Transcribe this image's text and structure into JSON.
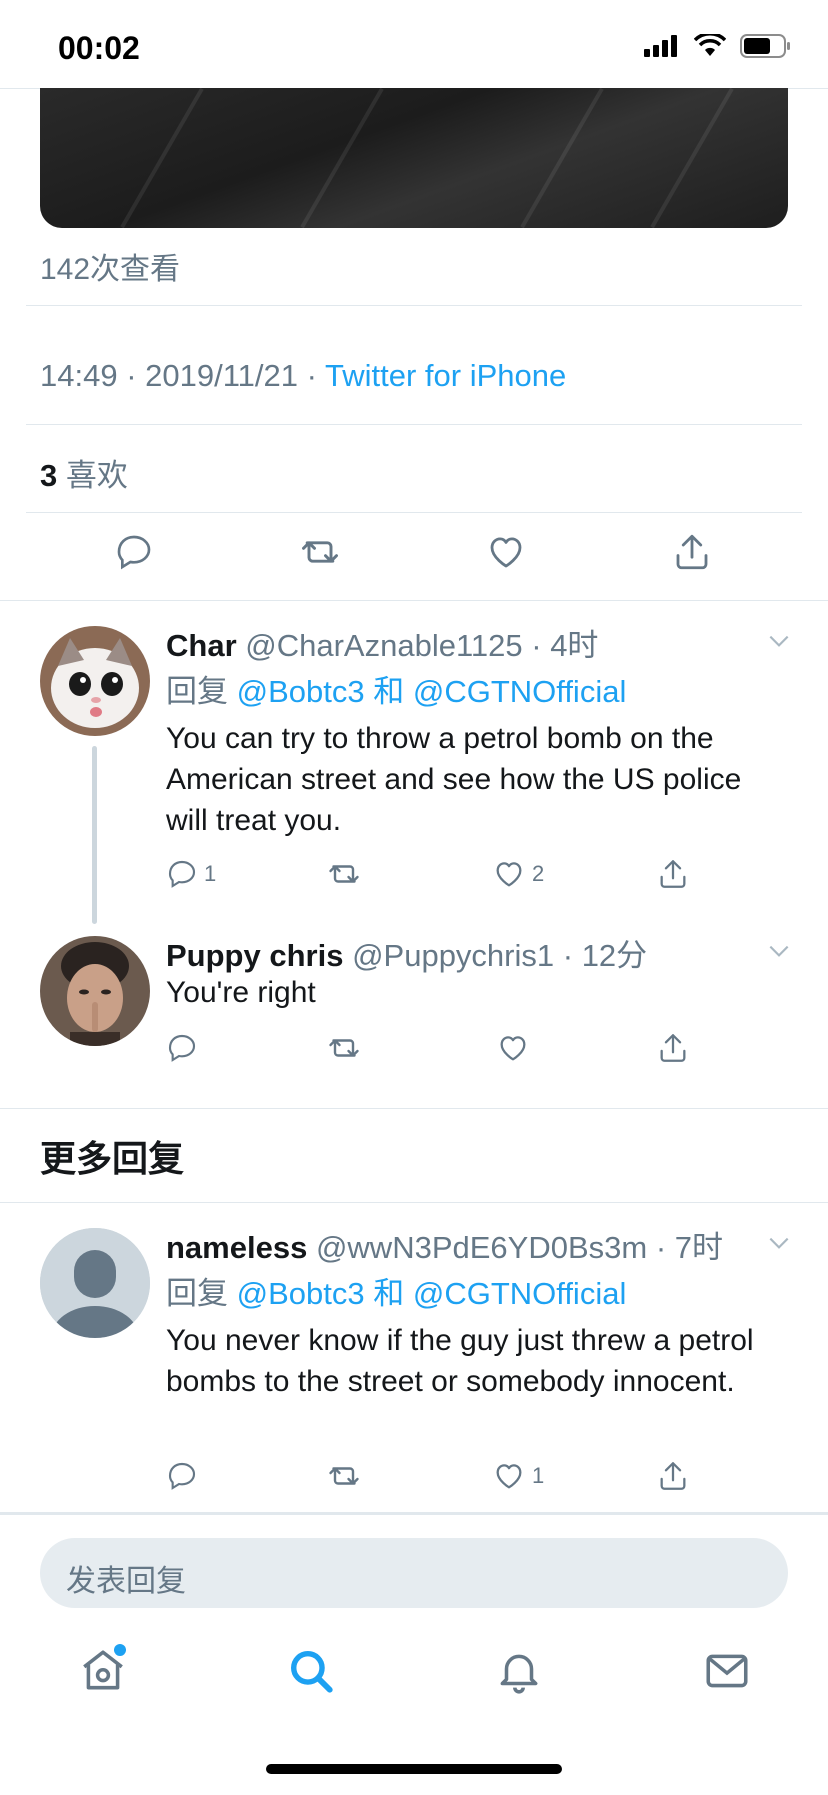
{
  "status_bar": {
    "time": "00:02"
  },
  "tweet": {
    "views": "142次查看",
    "time": "14:49",
    "date": "2019/11/21",
    "source": "Twitter for iPhone",
    "likes_count": "3",
    "likes_label": "喜欢"
  },
  "replies": [
    {
      "name": "Char",
      "handle": "@CharAznable1125",
      "time": "4时",
      "reply_prefix": "回复",
      "mention1": "@Bobtc3",
      "conj": "和",
      "mention2": "@CGTNOfficial",
      "text": "You can try to throw a petrol bomb on the American street and see how the US police will treat you.",
      "reply_count": "1",
      "like_count": "2"
    },
    {
      "name": "Puppy chris",
      "handle": "@Puppychris1",
      "time": "12分",
      "text": "You're right"
    }
  ],
  "more_replies": {
    "title": "更多回复",
    "items": [
      {
        "name": "nameless",
        "handle": "@wwN3PdE6YD0Bs3m",
        "time": "7时",
        "reply_prefix": "回复",
        "mention1": "@Bobtc3",
        "conj": "和",
        "mention2": "@CGTNOfficial",
        "text": "You never know if the guy just threw a petrol bombs to the street or somebody innocent.",
        "like_count": "1"
      }
    ]
  },
  "compose": {
    "placeholder": "发表回复"
  },
  "colors": {
    "accent": "#1da1f2",
    "secondary_text": "#657786",
    "divider": "#e1e8ed"
  },
  "icons": [
    "home-icon",
    "search-icon",
    "bell-icon",
    "mail-icon",
    "reply-icon",
    "retweet-icon",
    "like-icon",
    "share-icon",
    "chevron-down-icon"
  ]
}
